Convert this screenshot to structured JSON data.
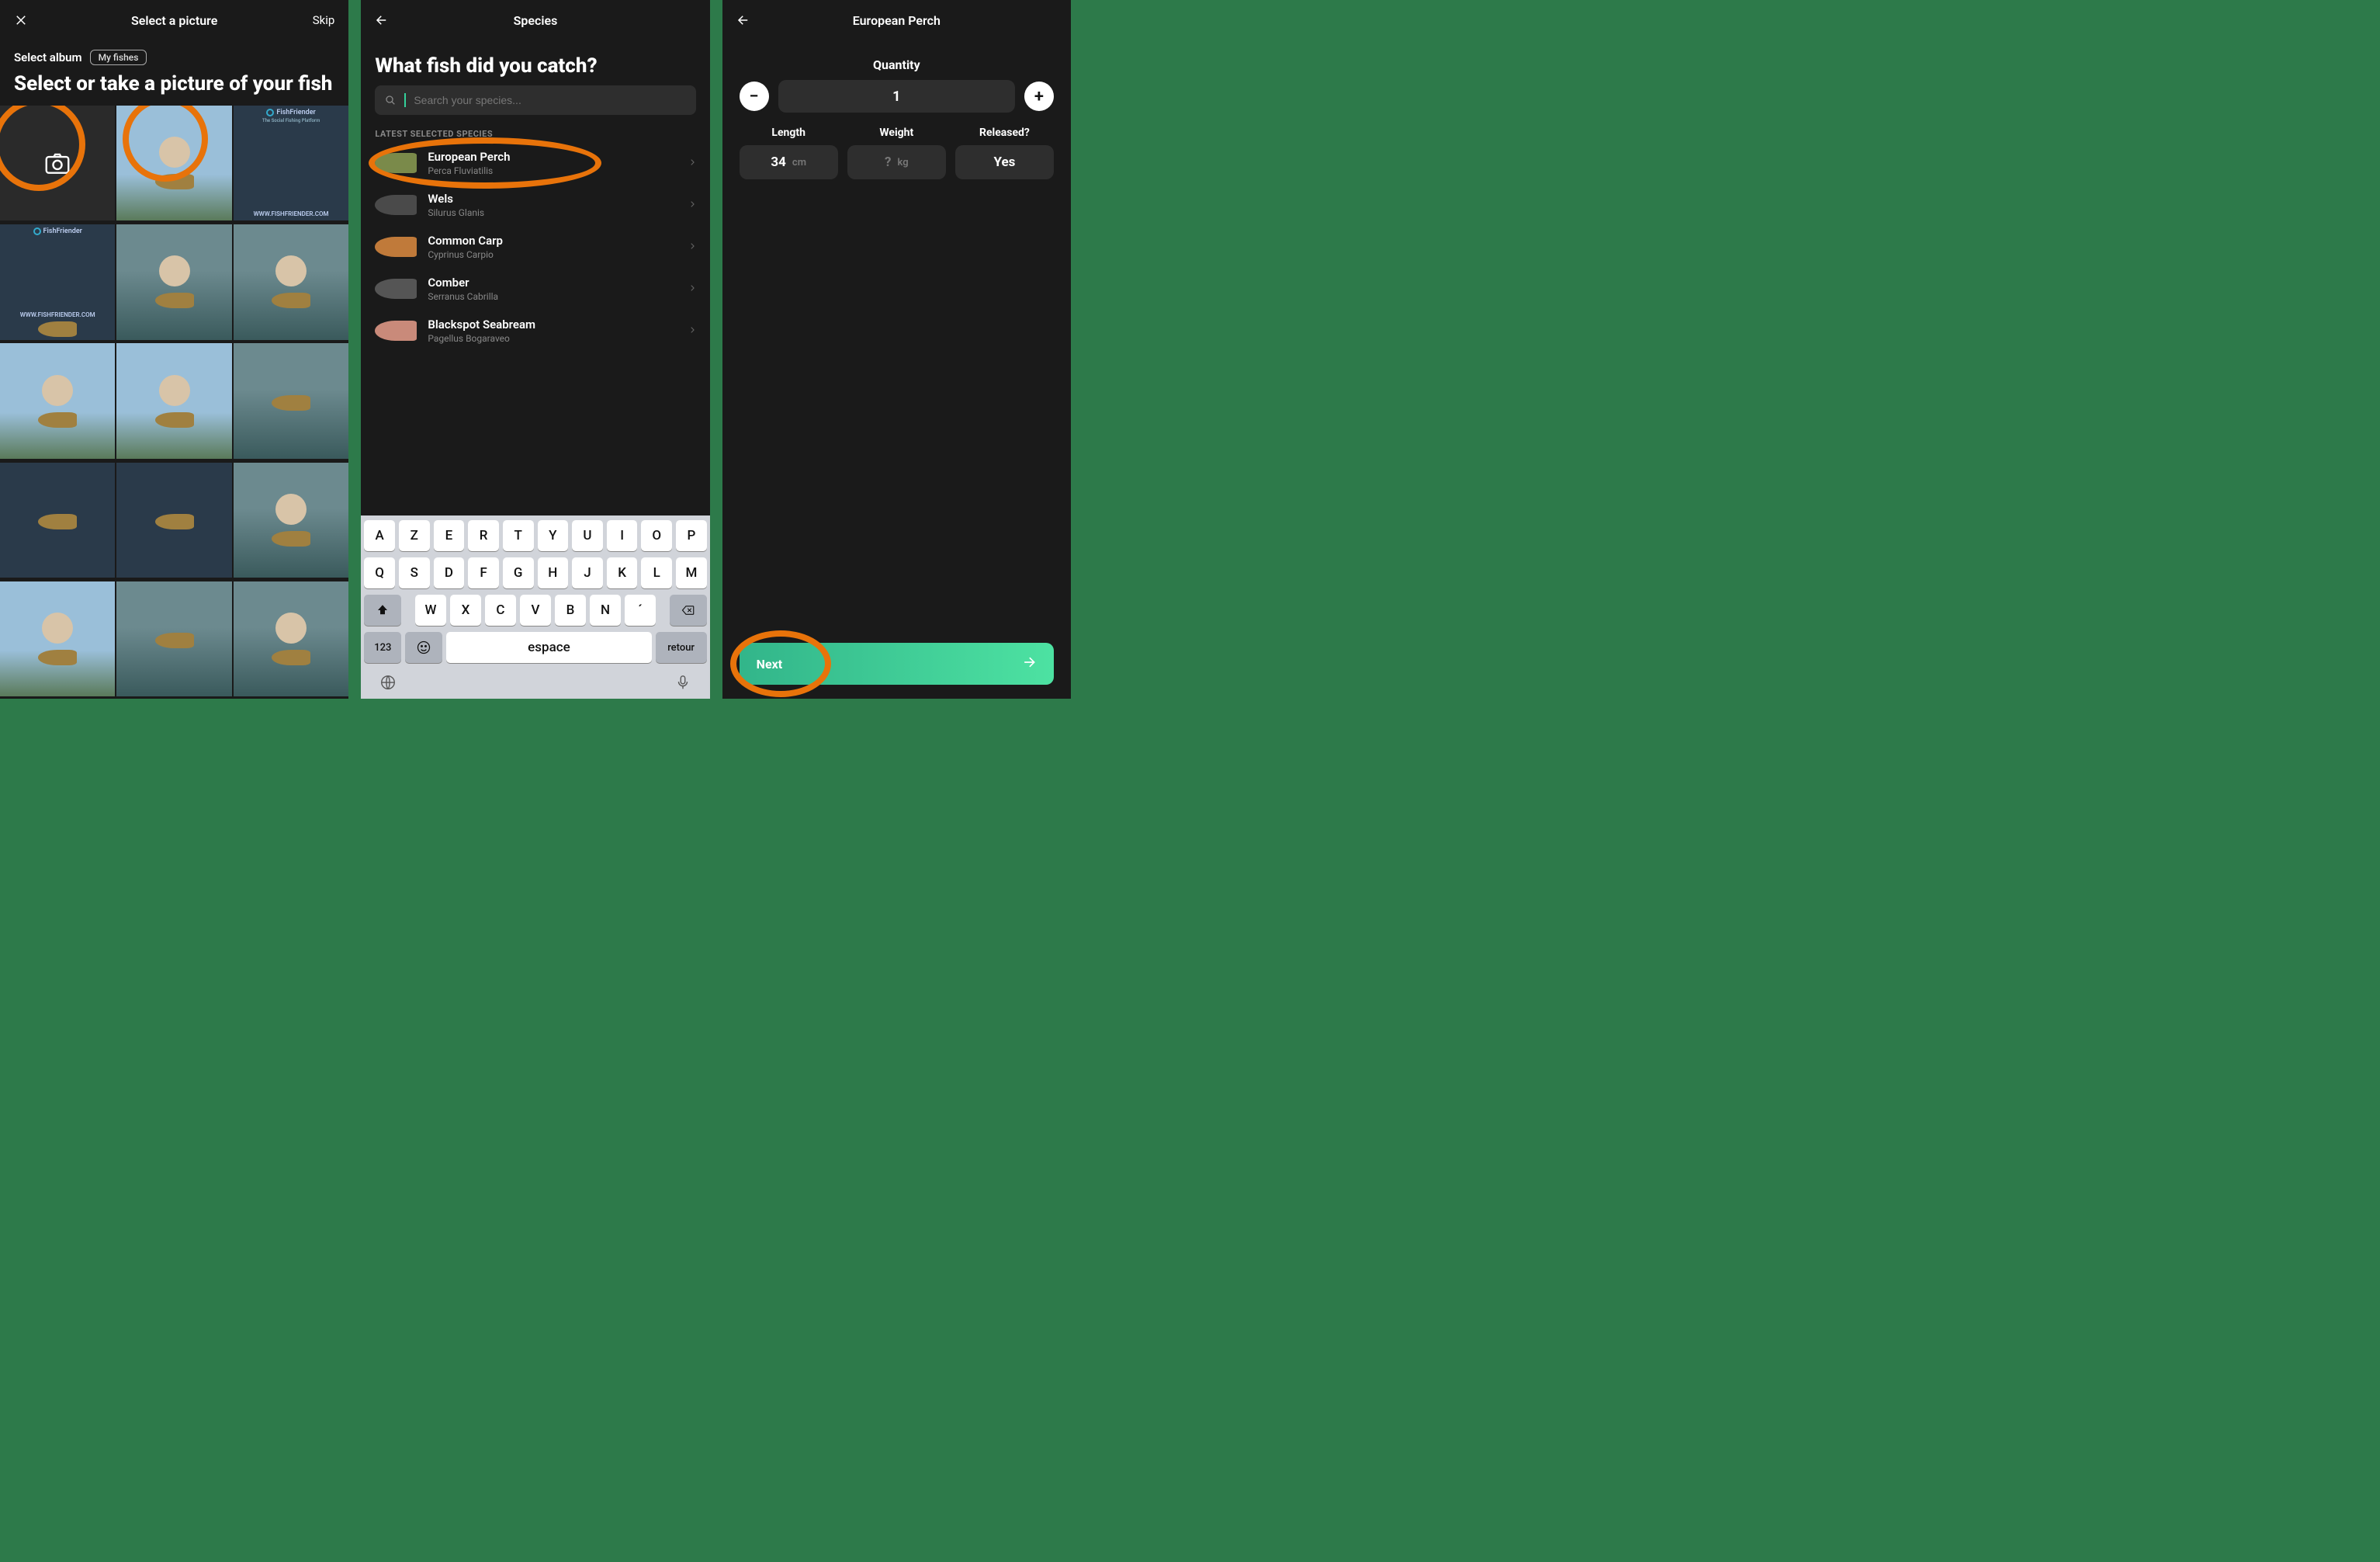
{
  "screen1": {
    "title": "Select a picture",
    "skip": "Skip",
    "album_label": "Select album",
    "album_chip": "My fishes",
    "heading": "Select or take a picture of your fish",
    "ruler_brand": "FishFriender",
    "ruler_tagline": "The Social Fishing Platform",
    "ruler_url": "WWW.FISHFRIENDER.COM"
  },
  "screen2": {
    "title": "Species",
    "heading": "What fish did you catch?",
    "search_placeholder": "Search your species...",
    "section_label": "LATEST SELECTED SPECIES",
    "species": [
      {
        "name": "European Perch",
        "latin": "Perca Fluviatilis",
        "color": "#7a8a4a"
      },
      {
        "name": "Wels",
        "latin": "Silurus Glanis",
        "color": "#4a4a4a"
      },
      {
        "name": "Common Carp",
        "latin": "Cyprinus Carpio",
        "color": "#c07a3a"
      },
      {
        "name": "Comber",
        "latin": "Serranus Cabrilla",
        "color": "#555"
      },
      {
        "name": "Blackspot Seabream",
        "latin": "Pagellus Bogaraveo",
        "color": "#c98a7a"
      }
    ],
    "keyboard": {
      "row1": [
        "A",
        "Z",
        "E",
        "R",
        "T",
        "Y",
        "U",
        "I",
        "O",
        "P"
      ],
      "row2": [
        "Q",
        "S",
        "D",
        "F",
        "G",
        "H",
        "J",
        "K",
        "L",
        "M"
      ],
      "row3": [
        "W",
        "X",
        "C",
        "V",
        "B",
        "N",
        "´"
      ],
      "num_key": "123",
      "space": "espace",
      "return": "retour"
    }
  },
  "screen3": {
    "title": "European Perch",
    "quantity_label": "Quantity",
    "quantity_value": "1",
    "metrics": {
      "length": {
        "label": "Length",
        "value": "34",
        "unit": "cm"
      },
      "weight": {
        "label": "Weight",
        "value": "?",
        "unit": "kg"
      },
      "released": {
        "label": "Released?",
        "value": "Yes"
      }
    },
    "next": "Next"
  }
}
